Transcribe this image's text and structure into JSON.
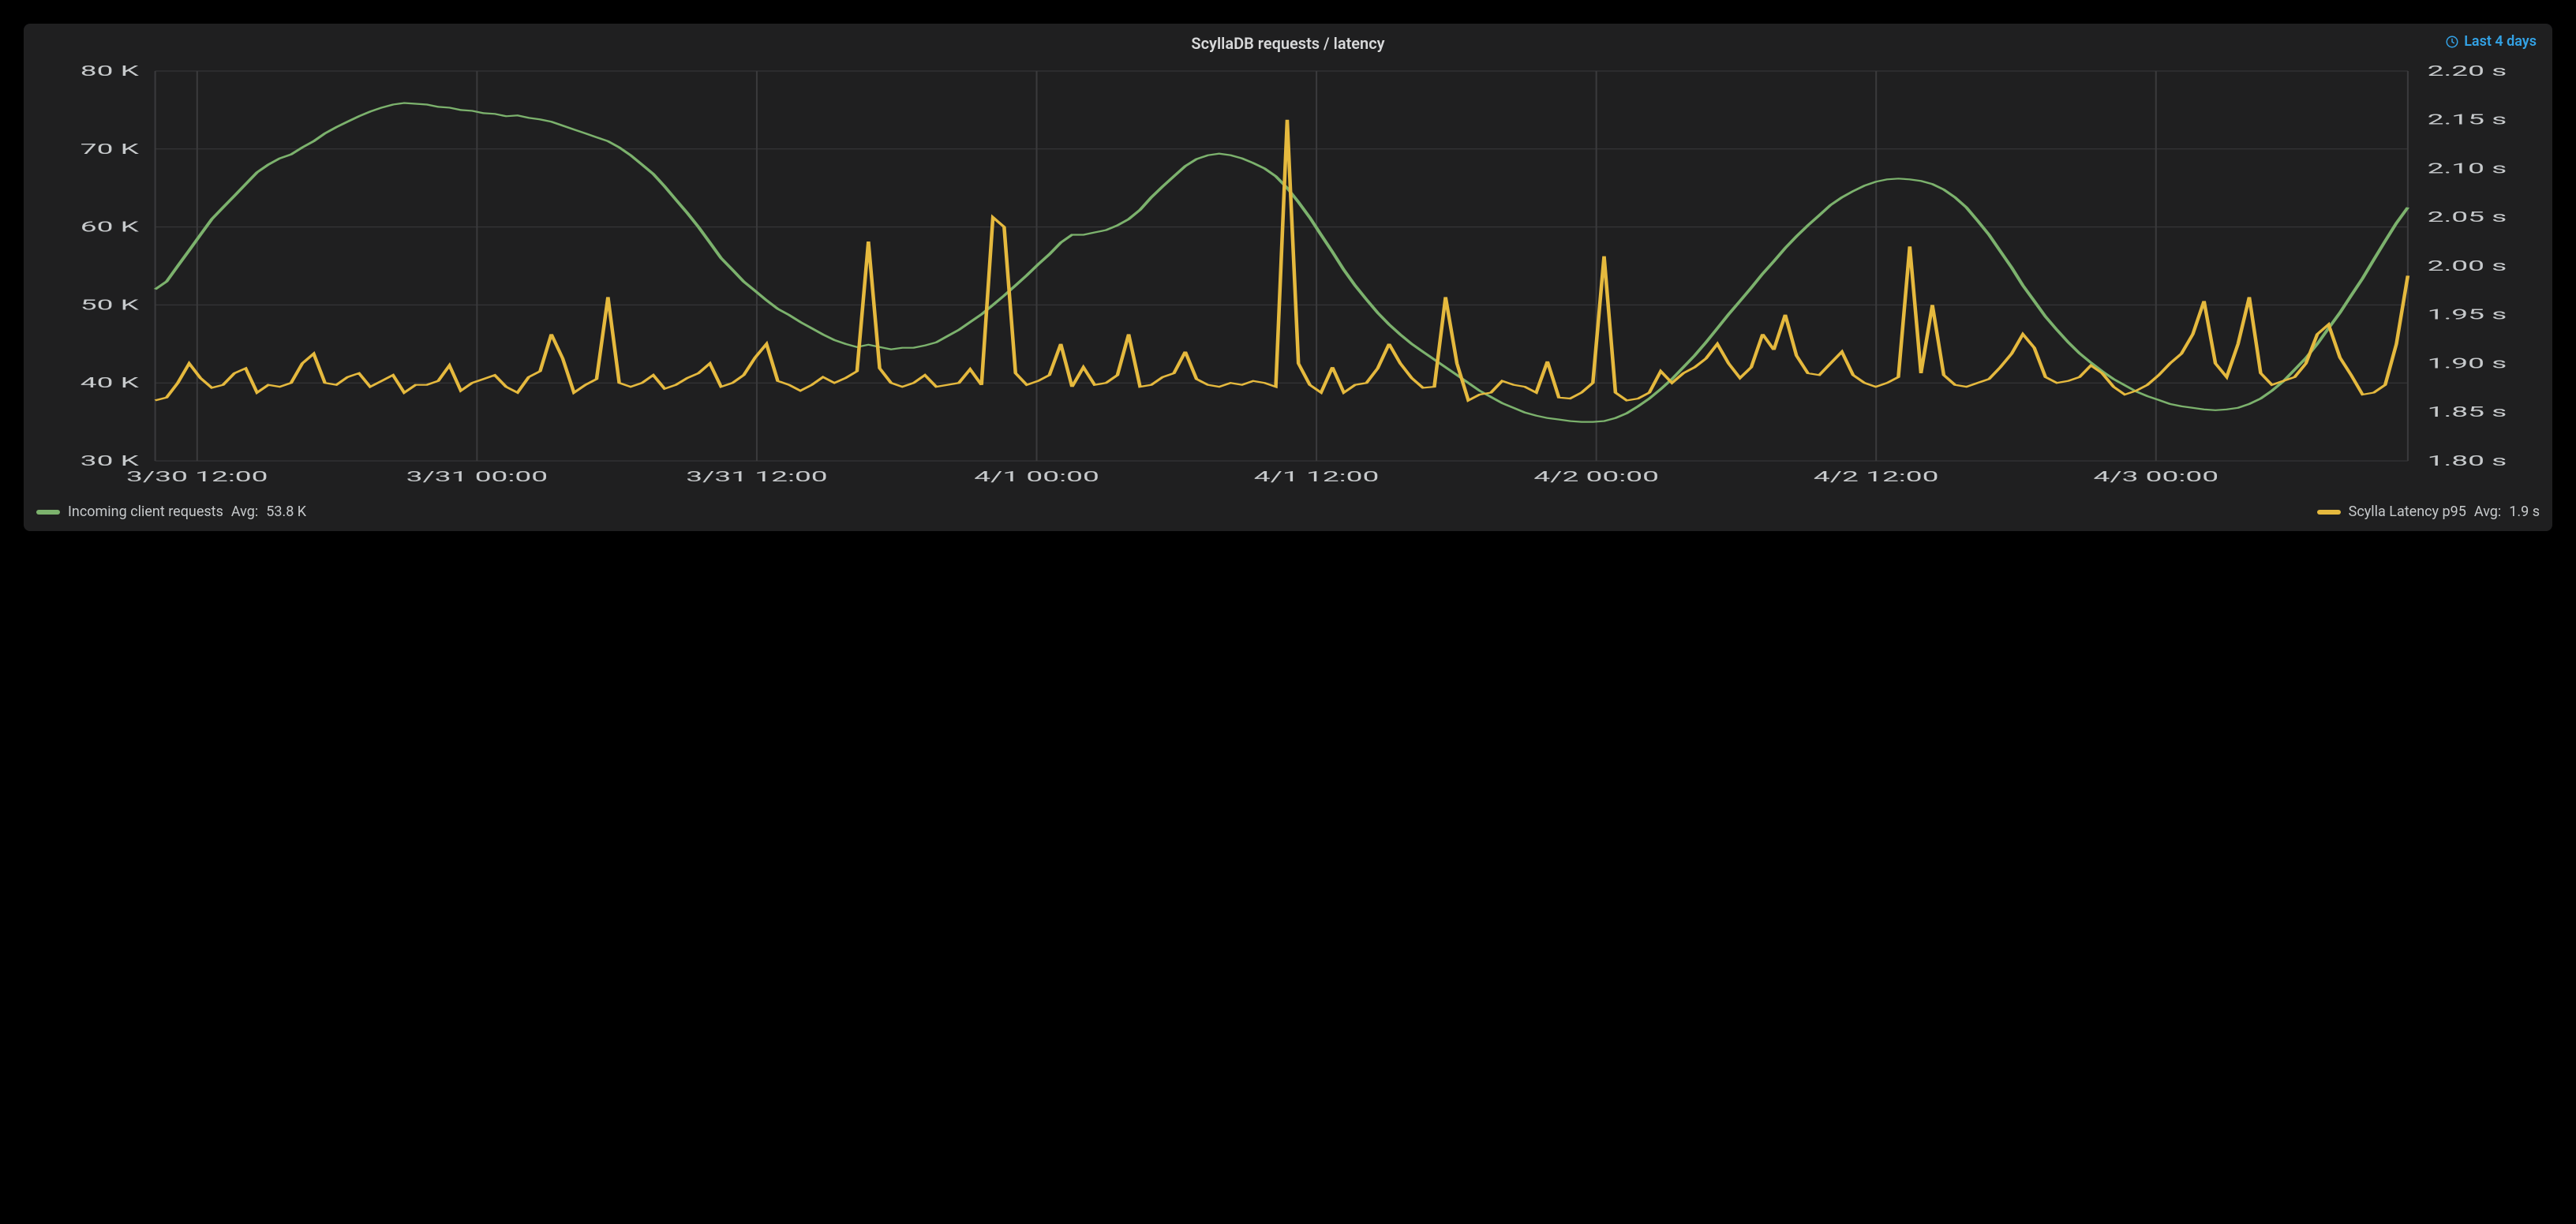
{
  "panel": {
    "title": "ScyllaDB requests / latency",
    "time_range_label": "Last 4 days"
  },
  "legend": {
    "left": {
      "color": "#7cb26d",
      "name": "Incoming client requests",
      "agg_label": "Avg:",
      "agg_value": "53.8 K"
    },
    "right": {
      "color": "#e5b93e",
      "name": "Scylla Latency p95",
      "agg_label": "Avg:",
      "agg_value": "1.9 s"
    }
  },
  "chart_data": {
    "type": "line",
    "x_ticks": [
      "3/30 12:00",
      "3/31 00:00",
      "3/31 12:00",
      "4/1 00:00",
      "4/1 12:00",
      "4/2 00:00",
      "4/2 12:00",
      "4/3 00:00"
    ],
    "y_left": {
      "min": 30000,
      "max": 80000,
      "ticks": [
        "30 K",
        "40 K",
        "50 K",
        "60 K",
        "70 K",
        "80 K"
      ],
      "label": ""
    },
    "y_right": {
      "min": 1.8,
      "max": 2.2,
      "ticks": [
        "1.80 s",
        "1.85 s",
        "1.90 s",
        "1.95 s",
        "2.00 s",
        "2.05 s",
        "2.10 s",
        "2.15 s",
        "2.20 s"
      ],
      "label": ""
    },
    "n_points": 200,
    "series": [
      {
        "name": "Incoming client requests",
        "axis": "left",
        "color": "#7cb26d",
        "values": [
          52000,
          53000,
          55000,
          57000,
          59000,
          61000,
          62500,
          64000,
          65500,
          67000,
          68000,
          68800,
          69300,
          70200,
          71000,
          72000,
          72800,
          73500,
          74200,
          74800,
          75300,
          75700,
          75900,
          75800,
          75700,
          75400,
          75300,
          75000,
          74900,
          74600,
          74500,
          74200,
          74300,
          74000,
          73800,
          73500,
          73000,
          72500,
          72000,
          71500,
          71000,
          70200,
          69200,
          68000,
          66800,
          65200,
          63500,
          61800,
          60000,
          58000,
          56000,
          54500,
          53000,
          51800,
          50600,
          49500,
          48700,
          47800,
          47000,
          46200,
          45500,
          45000,
          44600,
          44900,
          44600,
          44300,
          44500,
          44500,
          44800,
          45200,
          46000,
          46800,
          47800,
          48800,
          50000,
          51200,
          52500,
          53800,
          55200,
          56500,
          58000,
          59000,
          59000,
          59300,
          59600,
          60200,
          61000,
          62200,
          63800,
          65200,
          66500,
          67800,
          68700,
          69200,
          69400,
          69200,
          68800,
          68200,
          67500,
          66500,
          65000,
          63200,
          61200,
          59000,
          56800,
          54500,
          52500,
          50700,
          49000,
          47500,
          46200,
          45000,
          44000,
          43000,
          42000,
          41000,
          40000,
          39000,
          38200,
          37400,
          36800,
          36200,
          35800,
          35500,
          35300,
          35100,
          35000,
          35000,
          35100,
          35500,
          36100,
          37000,
          38000,
          39200,
          40500,
          42000,
          43500,
          45200,
          47000,
          48800,
          50500,
          52200,
          54000,
          55600,
          57300,
          58800,
          60200,
          61500,
          62800,
          63800,
          64600,
          65300,
          65800,
          66100,
          66200,
          66100,
          65900,
          65500,
          64800,
          63800,
          62500,
          60800,
          59000,
          56900,
          54800,
          52500,
          50500,
          48500,
          46800,
          45200,
          43800,
          42600,
          41500,
          40500,
          39700,
          38900,
          38300,
          37800,
          37300,
          37000,
          36800,
          36600,
          36500,
          36600,
          36800,
          37300,
          38000,
          39000,
          40200,
          41700,
          43200,
          45000,
          47000,
          49000,
          51200,
          53400,
          55800,
          58200,
          60500,
          62500
        ]
      },
      {
        "name": "Scylla Latency p95",
        "axis": "right",
        "color": "#e5b93e",
        "values": [
          1.862,
          1.865,
          1.88,
          1.9,
          1.885,
          1.875,
          1.878,
          1.89,
          1.895,
          1.87,
          1.878,
          1.876,
          1.88,
          1.9,
          1.91,
          1.88,
          1.878,
          1.886,
          1.89,
          1.876,
          1.882,
          1.888,
          1.87,
          1.878,
          1.878,
          1.882,
          1.898,
          1.872,
          1.88,
          1.884,
          1.888,
          1.876,
          1.87,
          1.886,
          1.892,
          1.93,
          1.905,
          1.87,
          1.878,
          1.884,
          1.968,
          1.88,
          1.876,
          1.88,
          1.888,
          1.874,
          1.878,
          1.885,
          1.89,
          1.9,
          1.876,
          1.88,
          1.888,
          1.906,
          1.92,
          1.882,
          1.878,
          1.872,
          1.878,
          1.886,
          1.88,
          1.885,
          1.892,
          2.025,
          1.895,
          1.88,
          1.876,
          1.88,
          1.888,
          1.876,
          1.878,
          1.88,
          1.894,
          1.878,
          2.05,
          2.04,
          1.89,
          1.878,
          1.882,
          1.888,
          1.92,
          1.876,
          1.896,
          1.878,
          1.88,
          1.888,
          1.93,
          1.876,
          1.878,
          1.886,
          1.89,
          1.912,
          1.884,
          1.878,
          1.876,
          1.88,
          1.878,
          1.882,
          1.88,
          1.876,
          2.15,
          1.9,
          1.878,
          1.87,
          1.896,
          1.87,
          1.878,
          1.88,
          1.895,
          1.92,
          1.9,
          1.885,
          1.875,
          1.876,
          1.968,
          1.9,
          1.862,
          1.868,
          1.87,
          1.882,
          1.878,
          1.876,
          1.87,
          1.902,
          1.865,
          1.864,
          1.87,
          1.88,
          2.01,
          1.87,
          1.862,
          1.864,
          1.87,
          1.892,
          1.88,
          1.89,
          1.896,
          1.905,
          1.92,
          1.9,
          1.885,
          1.896,
          1.93,
          1.914,
          1.95,
          1.908,
          1.89,
          1.888,
          1.9,
          1.912,
          1.888,
          1.88,
          1.876,
          1.88,
          1.886,
          2.02,
          1.89,
          1.96,
          1.888,
          1.878,
          1.876,
          1.88,
          1.884,
          1.896,
          1.91,
          1.93,
          1.916,
          1.886,
          1.88,
          1.882,
          1.886,
          1.898,
          1.89,
          1.876,
          1.868,
          1.872,
          1.878,
          1.888,
          1.9,
          1.91,
          1.93,
          1.964,
          1.9,
          1.886,
          1.92,
          1.968,
          1.89,
          1.878,
          1.882,
          1.886,
          1.9,
          1.93,
          1.94,
          1.906,
          1.888,
          1.868,
          1.87,
          1.878,
          1.92,
          1.99
        ]
      }
    ]
  }
}
